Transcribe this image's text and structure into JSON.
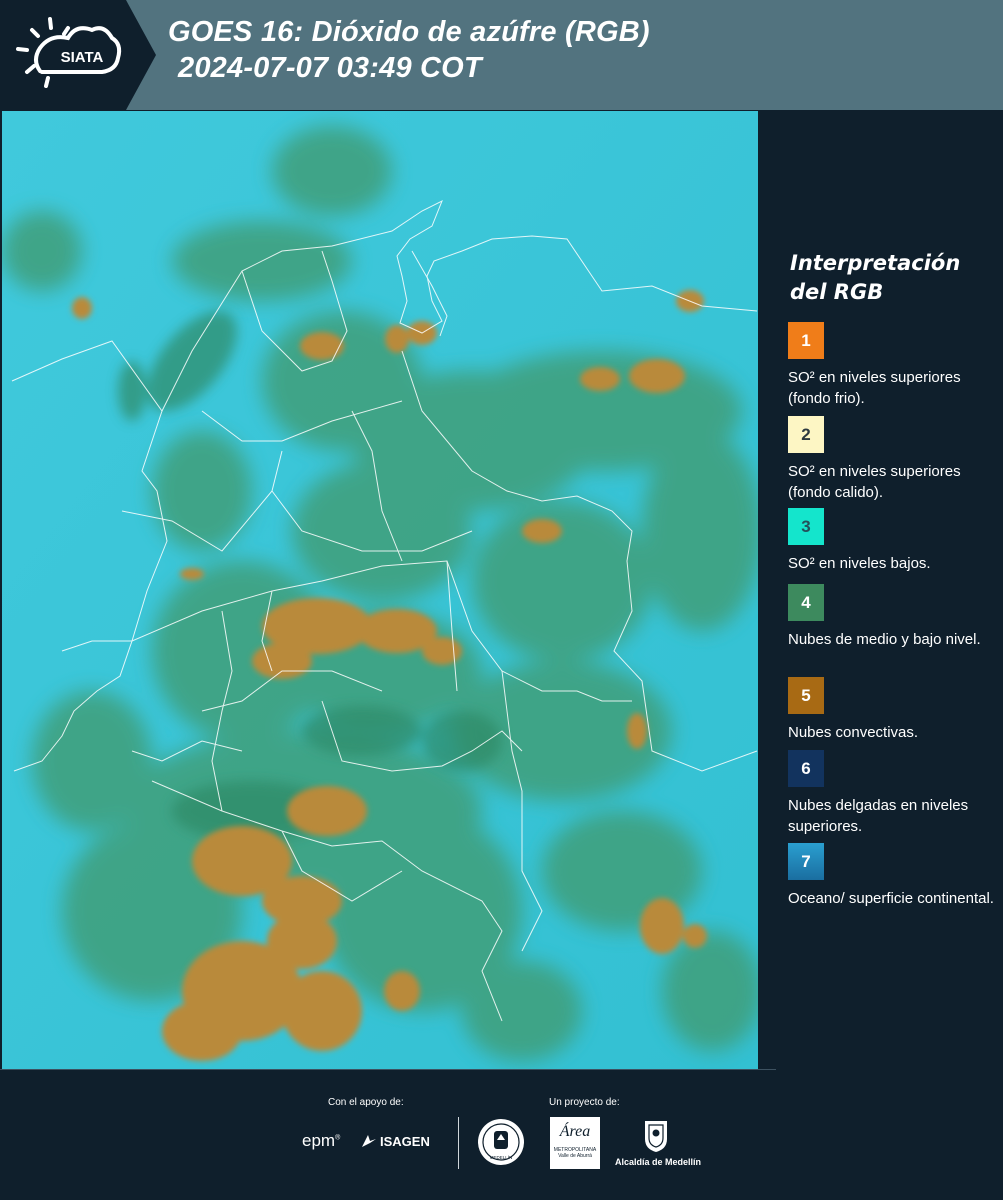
{
  "header": {
    "logo_text": "SIATA",
    "title_line1": "GOES 16: Dióxido de azúfre (RGB)",
    "title_line2": "2024-07-07 03:49 COT"
  },
  "legend": {
    "title_line1": "Interpretación",
    "title_line2": "del RGB",
    "items": [
      {
        "number": "1",
        "color": "#f07d19",
        "label": "SO² en niveles superiores (fondo frio)."
      },
      {
        "number": "2",
        "color": "#fdf6c4",
        "label": "SO² en niveles superiores (fondo calido)."
      },
      {
        "number": "3",
        "color": "#14e5cc",
        "label": "SO² en niveles bajos."
      },
      {
        "number": "4",
        "color": "#3d8a5e",
        "label": "Nubes de medio y bajo nivel."
      },
      {
        "number": "5",
        "color": "#a86a14",
        "label": "Nubes convectivas."
      },
      {
        "number": "6",
        "color": "#12335e",
        "label": "Nubes delgadas en niveles superiores."
      },
      {
        "number": "7",
        "color": "#1e86b8",
        "label": "Oceano/ superficie continental."
      }
    ]
  },
  "footer": {
    "support_label": "Con el apoyo de:",
    "project_label": "Un proyecto de:",
    "sponsor_epm": "epm",
    "sponsor_isagen": "ISAGEN",
    "seal_text": "MEDELLÍN",
    "area_script": "Área",
    "area_line1": "METROPOLITANA",
    "area_line2": "Valle de Aburrá",
    "alcaldia": "Alcaldía de Medellín"
  }
}
